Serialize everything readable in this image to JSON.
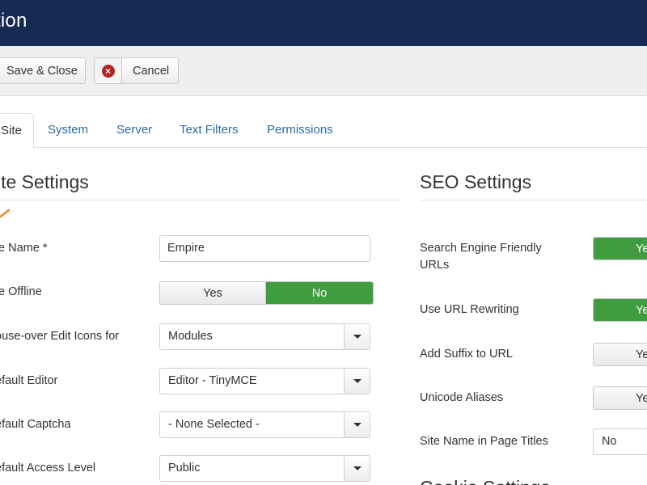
{
  "header": {
    "title": "tion"
  },
  "toolbar": {
    "save_close_label": "Save & Close",
    "cancel_label": "Cancel"
  },
  "tabs": [
    {
      "label": "Site",
      "active": true
    },
    {
      "label": "System"
    },
    {
      "label": "Server"
    },
    {
      "label": "Text Filters"
    },
    {
      "label": "Permissions"
    }
  ],
  "site_settings": {
    "title": "ite Settings",
    "fields": {
      "site_name": {
        "label": "te Name *",
        "value": "Empire"
      },
      "site_offline": {
        "label": "te Offline",
        "yes": "Yes",
        "no": "No",
        "selected": "No"
      },
      "mouseover_icons": {
        "label": "ouse-over Edit Icons for",
        "value": "Modules"
      },
      "default_editor": {
        "label": "efault Editor",
        "value": "Editor - TinyMCE"
      },
      "default_captcha": {
        "label": "efault Captcha",
        "value": "- None Selected -"
      },
      "default_access": {
        "label": "efault Access Level",
        "value": "Public"
      }
    }
  },
  "seo_settings": {
    "title": "SEO Settings",
    "fields": {
      "sef_urls": {
        "label_line1": "Search Engine Friendly",
        "label_line2": "URLs",
        "value": "Ye",
        "state": "on"
      },
      "url_rewriting": {
        "label": "Use URL Rewriting",
        "value": "Ye",
        "state": "on"
      },
      "add_suffix": {
        "label": "Add Suffix to URL",
        "value": "Ye",
        "state": "off"
      },
      "unicode_aliases": {
        "label": "Unicode Aliases",
        "value": "Ye",
        "state": "off"
      },
      "site_name_titles": {
        "label": "Site Name in Page Titles",
        "value": "No"
      }
    }
  },
  "next_section": {
    "title": "Cookie Settings"
  },
  "colors": {
    "header_bg": "#172a53",
    "toggle_on": "#3f9d3f",
    "link": "#2a6aa5",
    "cancel_icon": "#b02323"
  },
  "icons": {
    "cancel": "x-circle-icon",
    "select_arrow": "caret-down-icon"
  }
}
